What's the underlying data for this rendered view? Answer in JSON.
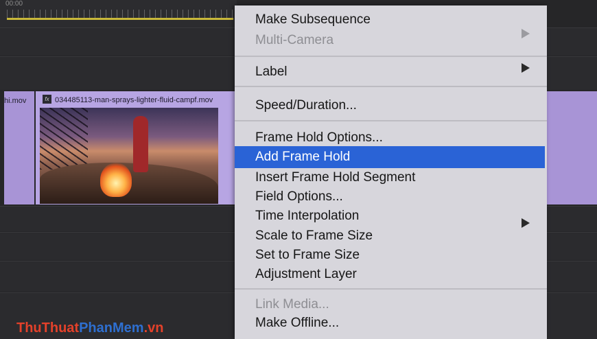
{
  "ruler": {
    "time": "00:00"
  },
  "timeline": {
    "left_clip_name": "hi.mov",
    "clip_name": "034485113-man-sprays-lighter-fluid-campf.mov",
    "fx_label": "fx"
  },
  "context_menu": {
    "items": [
      {
        "label": "Make Subsequence",
        "enabled": true,
        "submenu": false
      },
      {
        "label": "Multi-Camera",
        "enabled": false,
        "submenu": true
      },
      {
        "label": "Label",
        "enabled": true,
        "submenu": true
      },
      {
        "label": "Speed/Duration...",
        "enabled": true,
        "submenu": false
      },
      {
        "label": "Frame Hold Options...",
        "enabled": true,
        "submenu": false
      },
      {
        "label": "Add Frame Hold",
        "enabled": true,
        "submenu": false,
        "highlighted": true
      },
      {
        "label": "Insert Frame Hold Segment",
        "enabled": true,
        "submenu": false
      },
      {
        "label": "Field Options...",
        "enabled": true,
        "submenu": false
      },
      {
        "label": "Time Interpolation",
        "enabled": true,
        "submenu": true
      },
      {
        "label": "Scale to Frame Size",
        "enabled": true,
        "submenu": false
      },
      {
        "label": "Set to Frame Size",
        "enabled": true,
        "submenu": false
      },
      {
        "label": "Adjustment Layer",
        "enabled": true,
        "submenu": false
      },
      {
        "label": "Link Media...",
        "enabled": false,
        "submenu": false
      },
      {
        "label": "Make Offline...",
        "enabled": true,
        "submenu": false
      }
    ],
    "highlight_color": "#2a63d6"
  },
  "watermark": {
    "part1": "ThuThuat",
    "part2": "PhanMem",
    "part3": ".vn"
  }
}
